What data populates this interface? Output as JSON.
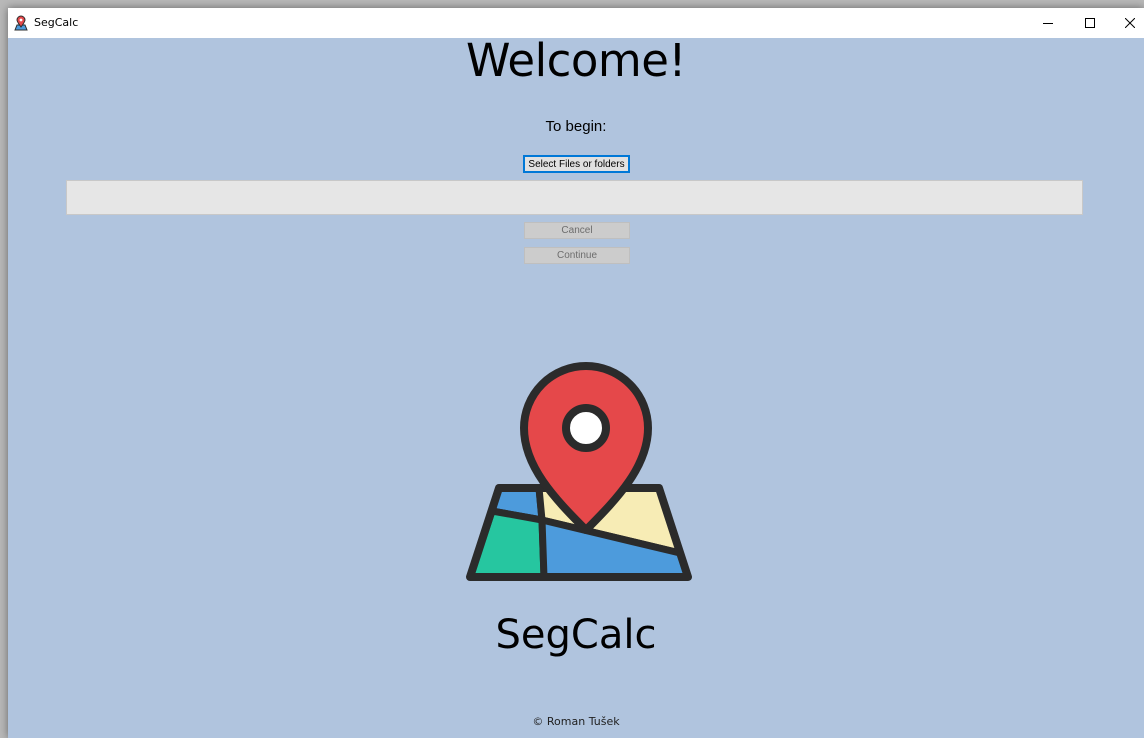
{
  "window": {
    "title": "SegCalc",
    "icon": "map-pin-icon",
    "controls": {
      "minimize": "minimize-icon",
      "maximize": "maximize-icon",
      "close": "close-icon"
    }
  },
  "main": {
    "heading": "Welcome!",
    "subheading": "To begin:",
    "select_button_label": "Select Files or folders",
    "path_box_value": "",
    "cancel_button_label": "Cancel",
    "continue_button_label": "Continue",
    "logo": "map-with-location-pin-icon",
    "app_name": "SegCalc",
    "copyright": "© Roman Tušek"
  },
  "colors": {
    "background": "#b0c4de",
    "pin_red": "#e5484a",
    "map_blue": "#4d9bdc",
    "map_yellow": "#f7ecb5",
    "map_green": "#26c6a0",
    "outline": "#2b2b2b"
  }
}
